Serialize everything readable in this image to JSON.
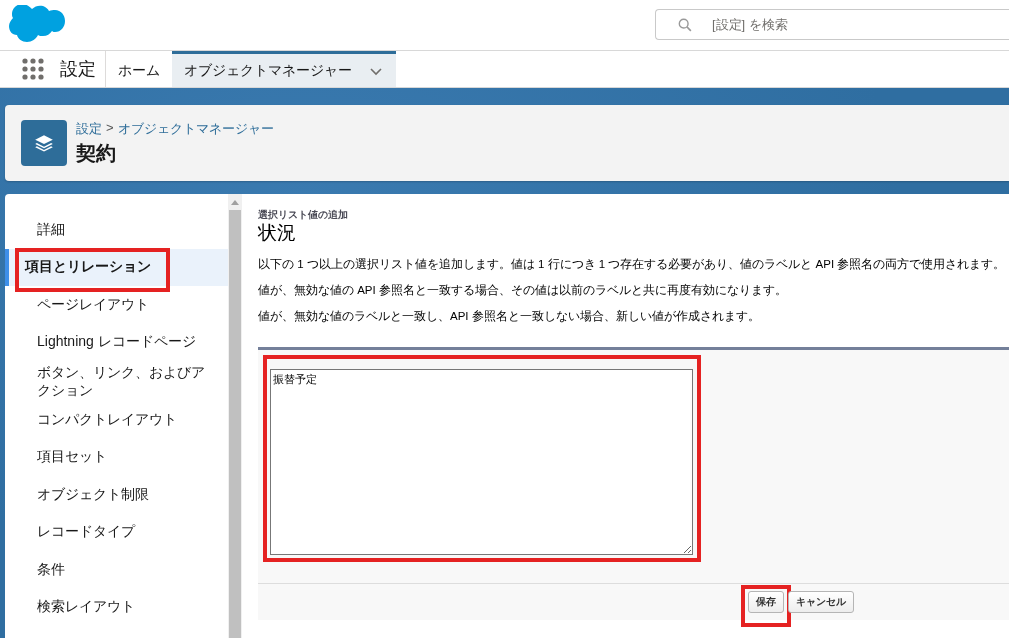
{
  "header": {
    "search": {
      "placeholder": "[設定] を検索"
    }
  },
  "nav": {
    "app_name": "設定",
    "tabs": [
      {
        "label": "ホーム",
        "selected": false,
        "dropdown": false
      },
      {
        "label": "オブジェクトマネージャー",
        "selected": true,
        "dropdown": true
      }
    ]
  },
  "page_header": {
    "breadcrumb": [
      {
        "label": "設定"
      },
      {
        "label": "オブジェクトマネージャー"
      }
    ],
    "separator": ">",
    "title": "契約"
  },
  "sidebar": {
    "items": [
      {
        "label": "詳細",
        "selected": false,
        "highlighted": false
      },
      {
        "label": "項目とリレーション",
        "selected": true,
        "highlighted": true
      },
      {
        "label": "ページレイアウト",
        "selected": false,
        "highlighted": false
      },
      {
        "label": "Lightning レコードページ",
        "selected": false,
        "highlighted": false
      },
      {
        "label": "ボタン、リンク、およびアクション",
        "selected": false,
        "highlighted": false
      },
      {
        "label": "コンパクトレイアウト",
        "selected": false,
        "highlighted": false
      },
      {
        "label": "項目セット",
        "selected": false,
        "highlighted": false
      },
      {
        "label": "オブジェクト制限",
        "selected": false,
        "highlighted": false
      },
      {
        "label": "レコードタイプ",
        "selected": false,
        "highlighted": false
      },
      {
        "label": "条件",
        "selected": false,
        "highlighted": false
      },
      {
        "label": "検索レイアウト",
        "selected": false,
        "highlighted": false
      }
    ]
  },
  "main": {
    "subtitle": "選択リスト値の追加",
    "title": "状況",
    "paragraphs": [
      "以下の 1 つ以上の選択リスト値を追加します。値は 1 行につき 1 つ存在する必要があり、値のラベルと API 参照名の両方で使用されます。",
      "値が、無効な値の API 参照名と一致する場合、その値は以前のラベルと共に再度有効になります。",
      "値が、無効な値のラベルと一致し、API 参照名と一致しない場合、新しい値が作成されます。"
    ],
    "values_field": {
      "value": "振替予定",
      "highlighted": true
    },
    "buttons": [
      {
        "label": "保存",
        "highlighted": true
      },
      {
        "label": "キャンセル",
        "highlighted": false
      }
    ]
  }
}
